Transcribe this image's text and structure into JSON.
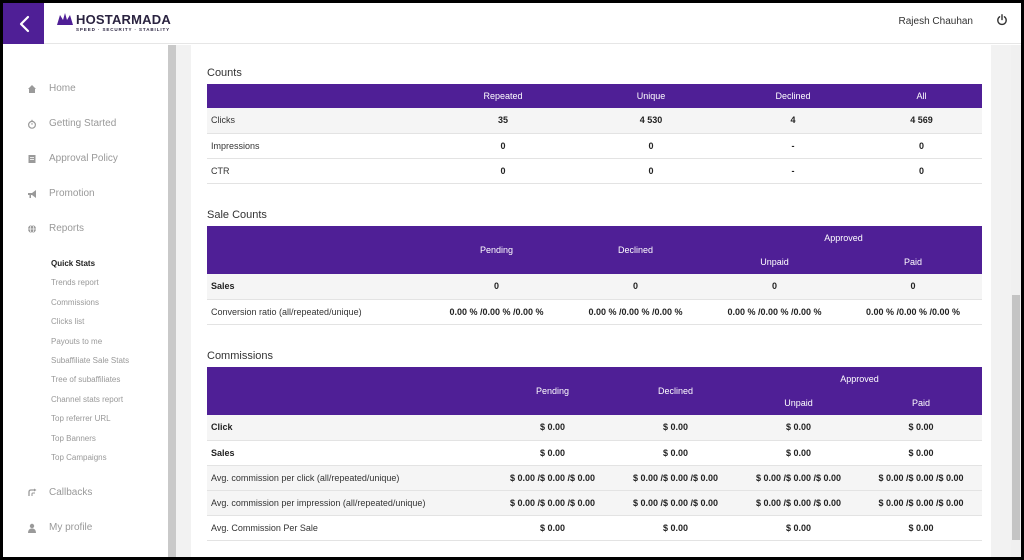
{
  "header": {
    "brand": "HOSTARMADA",
    "tagline": "SPEED · SECURITY · STABILITY",
    "user_name": "Rajesh Chauhan",
    "accent_color": "#4f1f96"
  },
  "sidebar": {
    "items": [
      {
        "label": "Home",
        "icon": "home-icon"
      },
      {
        "label": "Getting Started",
        "icon": "stopwatch-icon"
      },
      {
        "label": "Approval Policy",
        "icon": "document-icon"
      },
      {
        "label": "Promotion",
        "icon": "megaphone-icon"
      },
      {
        "label": "Reports",
        "icon": "globe-icon"
      }
    ],
    "sub_items": [
      "Quick Stats",
      "Trends report",
      "Commissions",
      "Clicks list",
      "Payouts to me",
      "Subaffiliate Sale Stats",
      "Tree of subaffiliates",
      "Channel stats report",
      "Top referrer URL",
      "Top Banners",
      "Top Campaigns"
    ],
    "bottom_items": [
      {
        "label": "Callbacks",
        "icon": "callbacks-icon"
      },
      {
        "label": "My profile",
        "icon": "user-icon"
      }
    ]
  },
  "counts": {
    "title": "Counts",
    "headers": [
      "",
      "Repeated",
      "Unique",
      "Declined",
      "All"
    ],
    "rows": [
      [
        "Clicks",
        "35",
        "4 530",
        "4",
        "4 569"
      ],
      [
        "Impressions",
        "0",
        "0",
        "-",
        "0"
      ],
      [
        "CTR",
        "0",
        "0",
        "-",
        "0"
      ]
    ]
  },
  "sale_counts": {
    "title": "Sale Counts",
    "headers": {
      "pending": "Pending",
      "declined": "Declined",
      "approved": "Approved",
      "unpaid": "Unpaid",
      "paid": "Paid"
    },
    "rows": [
      [
        "Sales",
        "0",
        "0",
        "0",
        "0"
      ],
      [
        "Conversion ratio (all/repeated/unique)",
        "0.00 % /0.00 % /0.00 %",
        "0.00 % /0.00 % /0.00 %",
        "0.00 % /0.00 % /0.00 %",
        "0.00 % /0.00 % /0.00 %"
      ]
    ]
  },
  "commissions": {
    "title": "Commissions",
    "headers": {
      "pending": "Pending",
      "declined": "Declined",
      "approved": "Approved",
      "unpaid": "Unpaid",
      "paid": "Paid"
    },
    "rows": [
      [
        "Click",
        "$ 0.00",
        "$ 0.00",
        "$ 0.00",
        "$ 0.00"
      ],
      [
        "Sales",
        "$ 0.00",
        "$ 0.00",
        "$ 0.00",
        "$ 0.00"
      ],
      [
        "Avg. commission per click (all/repeated/unique)",
        "$ 0.00 /$ 0.00 /$ 0.00",
        "$ 0.00 /$ 0.00 /$ 0.00",
        "$ 0.00 /$ 0.00 /$ 0.00",
        "$ 0.00 /$ 0.00 /$ 0.00"
      ],
      [
        "Avg. commission per impression (all/repeated/unique)",
        "$ 0.00 /$ 0.00 /$ 0.00",
        "$ 0.00 /$ 0.00 /$ 0.00",
        "$ 0.00 /$ 0.00 /$ 0.00",
        "$ 0.00 /$ 0.00 /$ 0.00"
      ],
      [
        "Avg. Commission Per Sale",
        "$ 0.00",
        "$ 0.00",
        "$ 0.00",
        "$ 0.00"
      ]
    ]
  }
}
